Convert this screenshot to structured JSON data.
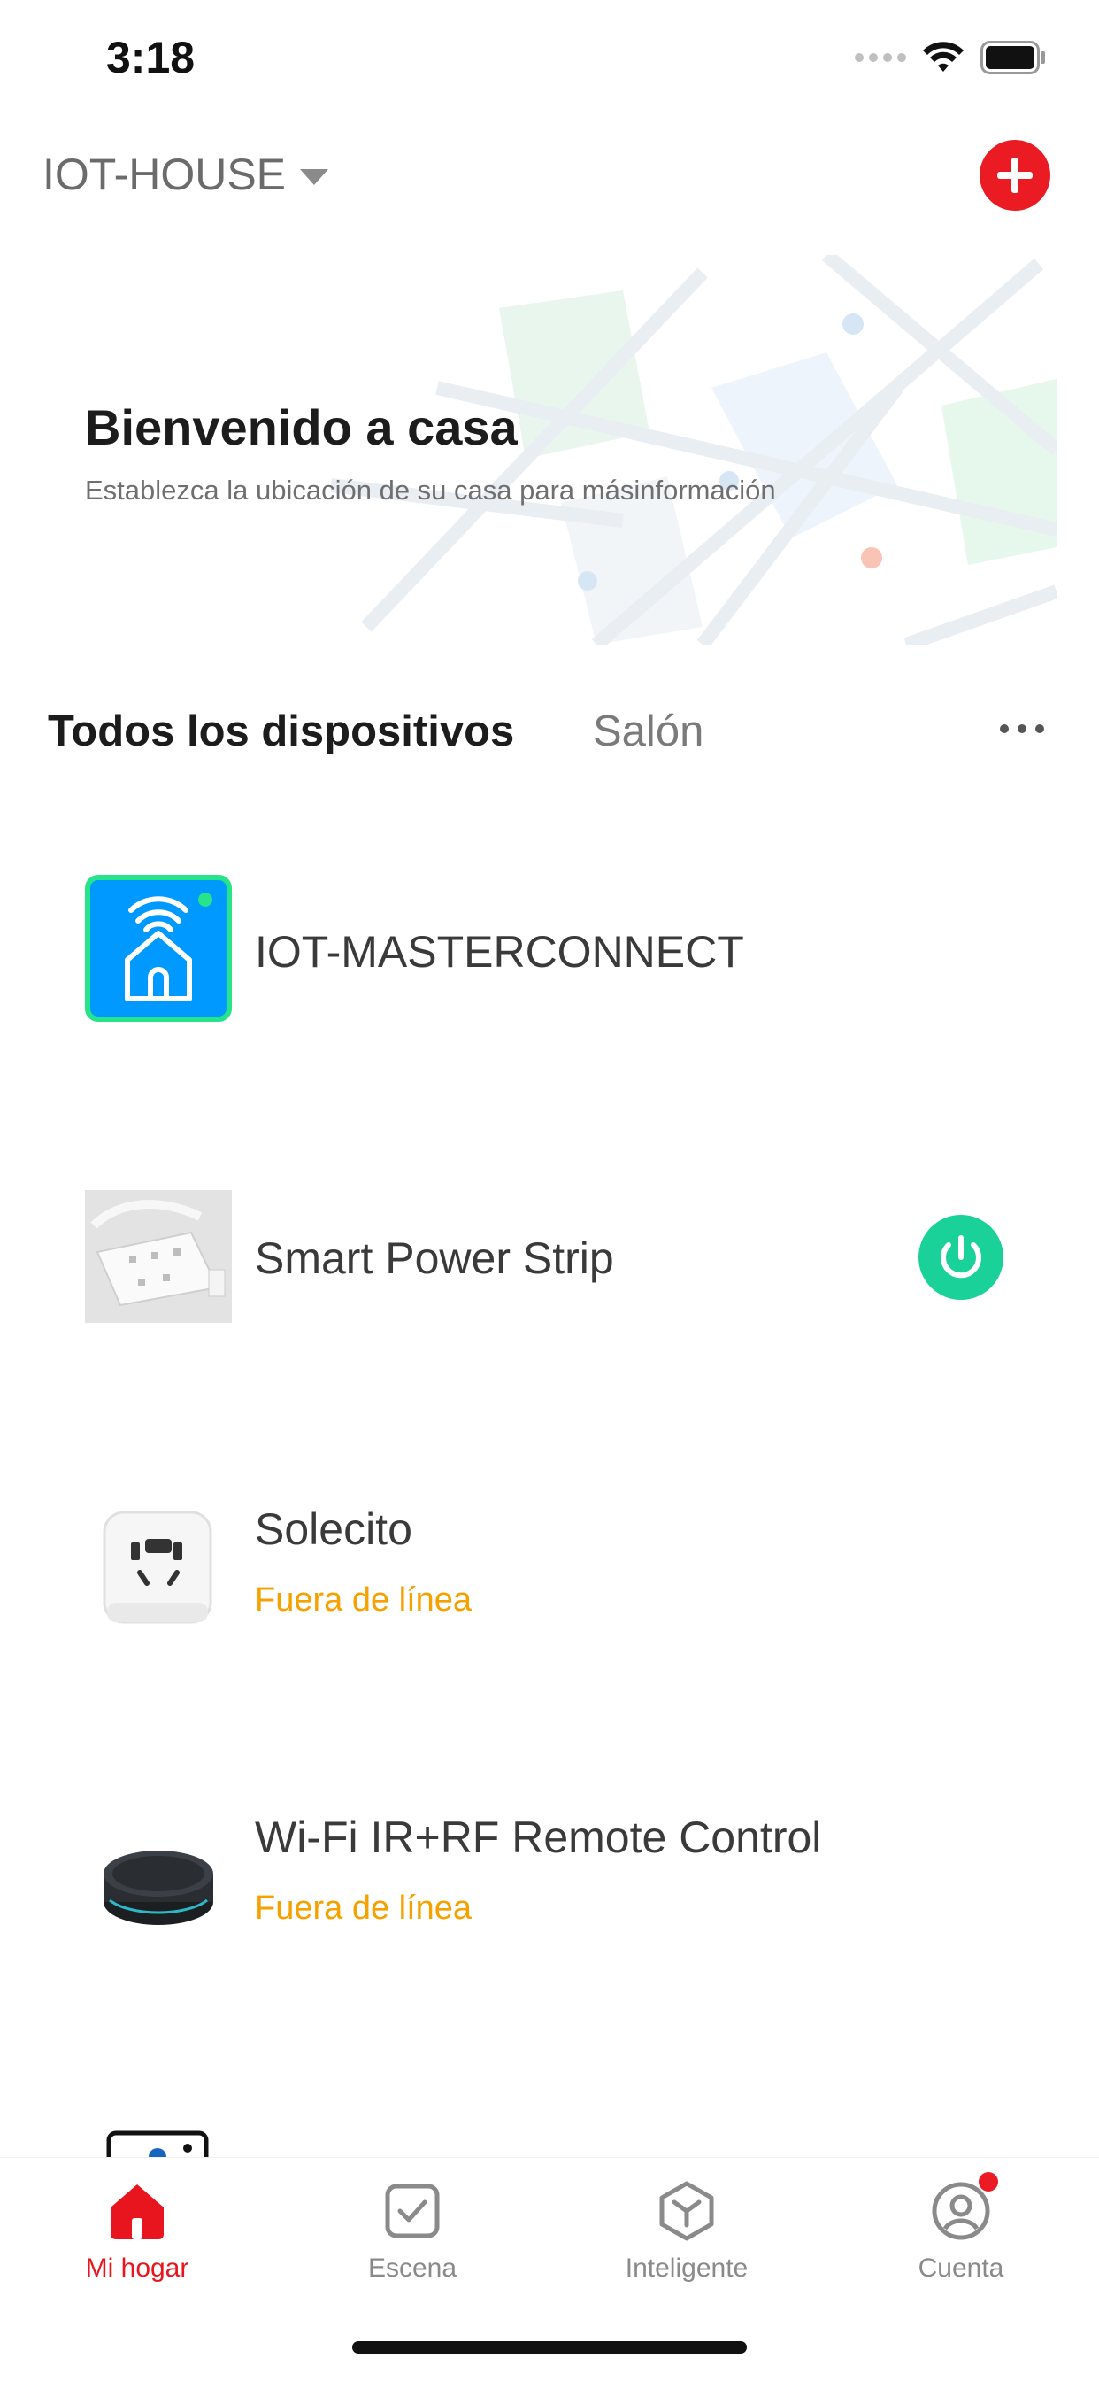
{
  "status_bar": {
    "time": "3:18"
  },
  "header": {
    "home_name": "IOT-HOUSE"
  },
  "welcome": {
    "title": "Bienvenido a casa",
    "subtitle": "Establezca la ubicación de su casa para másinformación"
  },
  "tabs": [
    {
      "label": "Todos los dispositivos",
      "selected": true
    },
    {
      "label": "Salón",
      "selected": false
    }
  ],
  "devices": [
    {
      "name": "IOT-MASTERCONNECT",
      "status": "",
      "icon": "wifi-home-icon"
    },
    {
      "name": "Smart Power Strip",
      "status": "",
      "icon": "power-strip-icon",
      "power": "on"
    },
    {
      "name": "Solecito",
      "status": "Fuera de línea",
      "icon": "smart-plug-icon"
    },
    {
      "name": "Wi-Fi IR+RF Remote Control",
      "status": "Fuera de línea",
      "icon": "ir-remote-hub-icon"
    }
  ],
  "bottom_nav": [
    {
      "label": "Mi hogar",
      "icon": "home-icon",
      "active": true
    },
    {
      "label": "Escena",
      "icon": "scene-check-icon",
      "active": false
    },
    {
      "label": "Inteligente",
      "icon": "smart-cube-icon",
      "active": false
    },
    {
      "label": "Cuenta",
      "icon": "account-icon",
      "active": false,
      "badge": true
    }
  ],
  "colors": {
    "accent_red": "#ea1b23",
    "offline_orange": "#f5a100",
    "power_green": "#1bd19a",
    "device_blue": "#0099ff",
    "device_border_green": "#27e38a"
  }
}
